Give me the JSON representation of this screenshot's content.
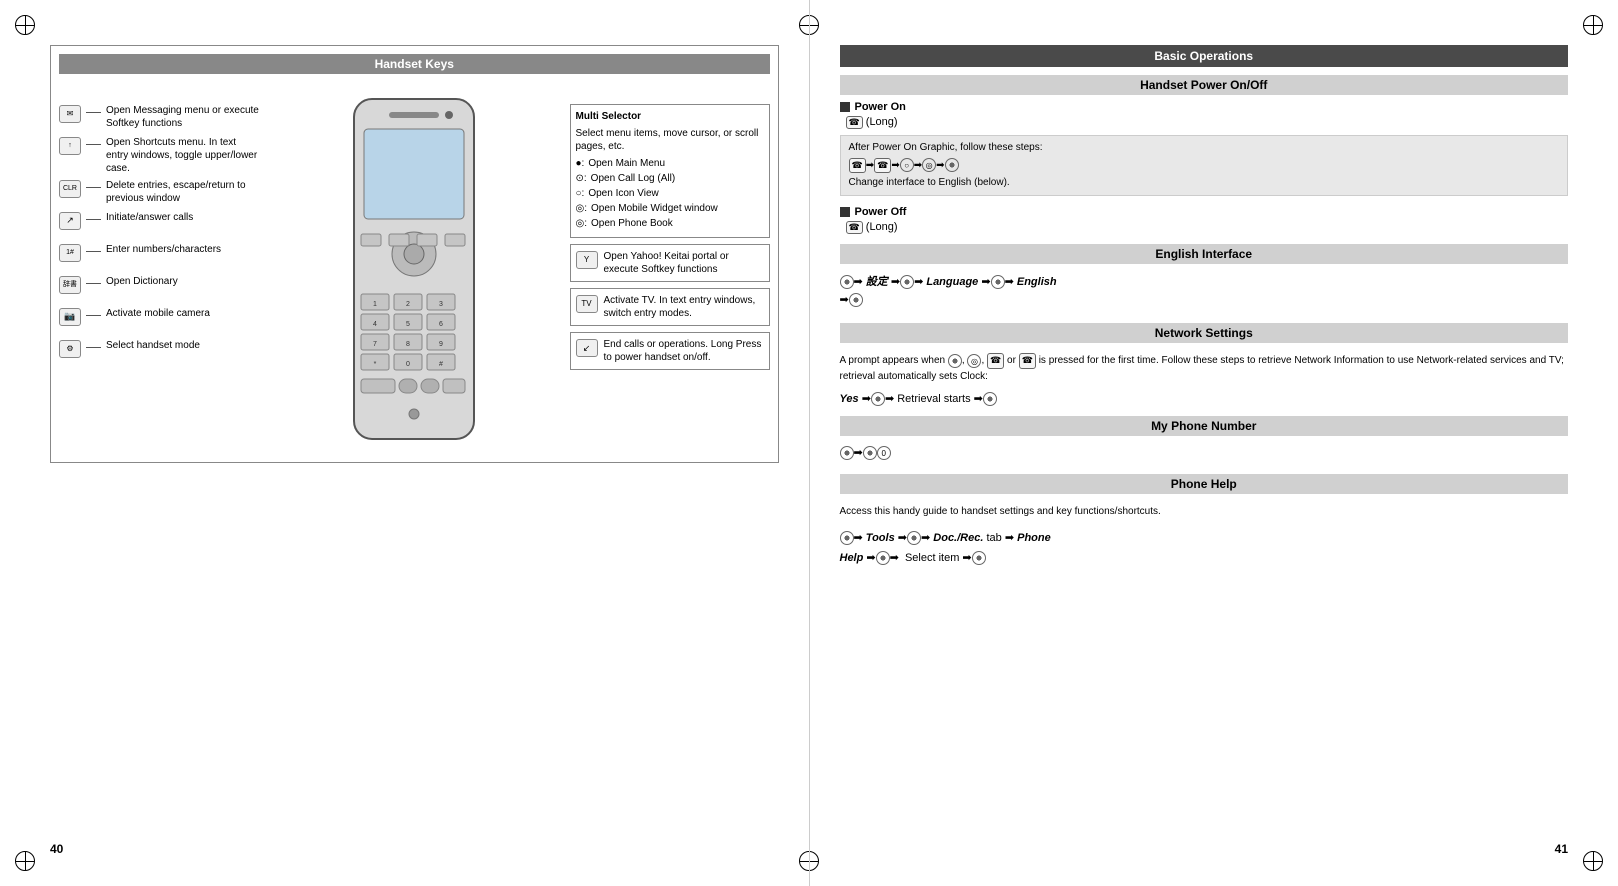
{
  "pages": {
    "left": {
      "page_number": "40",
      "section_title": "Handset Keys",
      "left_labels": [
        {
          "icon": "✉",
          "icon_type": "square",
          "text": "Open Messaging menu or execute Softkey functions"
        },
        {
          "icon": "↑",
          "icon_type": "square",
          "text": "Open Shortcuts menu. In text entry windows, toggle upper/lower case."
        },
        {
          "icon": "CLR",
          "icon_type": "square",
          "text": "Delete entries, escape/return to previous window"
        },
        {
          "icon": "↗",
          "icon_type": "square",
          "text": "Initiate/answer calls"
        },
        {
          "icon": "1#",
          "icon_type": "square",
          "text": "Enter numbers/characters"
        },
        {
          "icon": "辞書",
          "icon_type": "square",
          "text": "Open Dictionary"
        },
        {
          "icon": "📷",
          "icon_type": "square",
          "text": "Activate mobile camera"
        },
        {
          "icon": "⚙",
          "icon_type": "square",
          "text": "Select handset mode"
        }
      ],
      "right_callouts": [
        {
          "title": "Multi Selector",
          "description": "Select menu items, move cursor, or scroll pages, etc.",
          "items": [
            "●: Open Main Menu",
            "⊙: Open Call Log (All)",
            "○: Open Icon View",
            "◎: Open Mobile Widget window",
            "◎: Open Phone Book"
          ]
        },
        {
          "icon": "Y",
          "text": "Open Yahoo! Keitai portal or execute Softkey functions"
        },
        {
          "icon": "TV",
          "text": "Activate TV. In text entry windows, switch entry modes."
        },
        {
          "icon": "↙",
          "text": "End calls or operations. Long Press to power handset on/off."
        }
      ]
    },
    "right": {
      "page_number": "41",
      "section_title": "Basic Operations",
      "subsections": [
        {
          "title": "Handset Power On/Off",
          "type": "sub_header"
        },
        {
          "type": "power_on",
          "label": "Power On",
          "symbol": "☎",
          "long_text": "(Long)",
          "info_box": {
            "intro": "After Power On Graphic, follow these steps:",
            "steps": "☎➡☎➡○➡◎➡●",
            "follow": "Change interface to English (below)."
          }
        },
        {
          "type": "power_off",
          "label": "Power Off",
          "symbol": "☎",
          "long_text": "(Long)"
        },
        {
          "title": "English Interface",
          "type": "sub_header"
        },
        {
          "type": "english_interface",
          "content": "●➡ 設定 ➡●➡ Language ➡●➡ English ➡●"
        },
        {
          "title": "Network Settings",
          "type": "sub_header"
        },
        {
          "type": "network_settings",
          "intro": "A prompt appears when ●, ◎, ☎ or ☎ is pressed for the first time. Follow these steps to retrieve Network Information to use Network-related services and TV; retrieval automatically sets Clock:",
          "steps": "Yes ➡●➡ Retrieval starts ➡●"
        },
        {
          "title": "My Phone Number",
          "type": "sub_header"
        },
        {
          "type": "my_phone",
          "content": "●➡●◎"
        },
        {
          "title": "Phone Help",
          "type": "sub_header"
        },
        {
          "type": "phone_help",
          "intro": "Access this handy guide to handset settings and key functions/shortcuts.",
          "steps": "●➡ Tools ➡●➡ Doc./Rec. tab ➡ Phone Help ➡●➡  Select item ➡●"
        }
      ]
    }
  }
}
